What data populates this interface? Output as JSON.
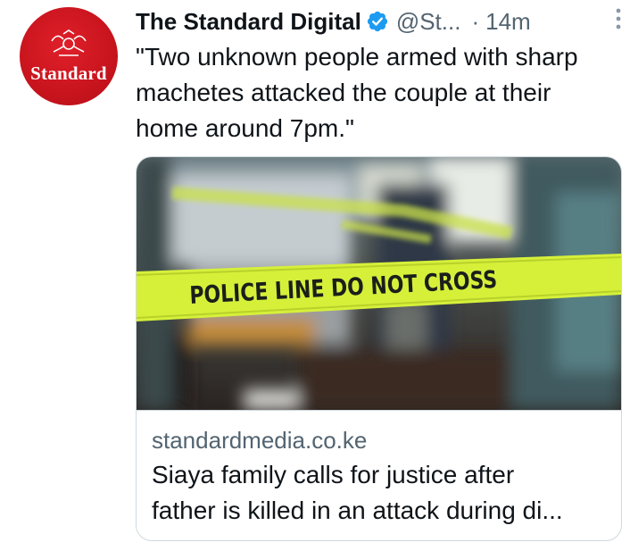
{
  "tweet": {
    "avatar": {
      "brand_text": "Standard",
      "color": "#c8141d"
    },
    "author": {
      "display_name": "The Standard Digital",
      "verified_icon": "verified-badge-icon",
      "handle": "@St...",
      "separator": "·",
      "time": "14m"
    },
    "more_icon": "more-vertical-icon",
    "text": "\"Two unknown people armed with sharp machetes attacked the couple at their home around 7pm.\"",
    "card": {
      "image": {
        "tape_text": "POLICE LINE DO NOT CROSS"
      },
      "domain": "standardmedia.co.ke",
      "title_line1": "Siaya family calls for justice after",
      "title_line2": "father is killed in an attack during di..."
    }
  },
  "colors": {
    "primary_text": "#0f1419",
    "secondary_text": "#536471",
    "verified_blue": "#1d9bf0",
    "border": "#cfd9de",
    "tape_yellow": "#d6f03a"
  }
}
